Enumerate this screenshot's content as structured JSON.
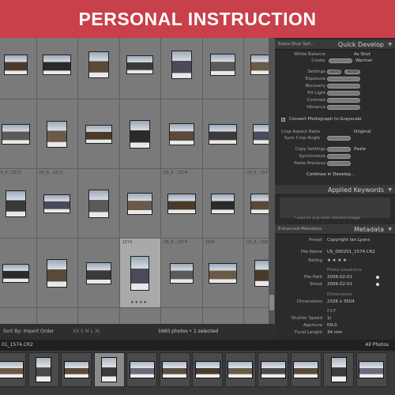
{
  "banner": {
    "text": "PERSONAL INSTRUCTION"
  },
  "grid": {
    "row1_labels": [
      "1574",
      "US_6...1553",
      "",
      "1557",
      "US_6...1559",
      "",
      "US_6...1560"
    ],
    "row3_labels": [
      "US_6...1571",
      "US_6...1573",
      "",
      "",
      "US_6...1574",
      "",
      "US_6...1577"
    ],
    "row4_labels": [
      "",
      "",
      "",
      "1574",
      "US_6...1574",
      "1582",
      "US_6...1583"
    ],
    "stars_selected": "★★★★·"
  },
  "toolbar": {
    "sort_label": "Sort By: Import Order",
    "sizes": "XS  S  M  L  XL",
    "count": "1660 photos • 1 selected"
  },
  "filmbar": {
    "filename": "01_1574.CR2",
    "filter": "All Photos"
  },
  "panel": {
    "preset_strip": "Sepia Blue Spli...",
    "quick_develop": {
      "title": "Quick Develop",
      "white_balance_label": "White Balance",
      "white_balance_value": "As Shot",
      "cooler": "Cooler",
      "warmer": "Warmer",
      "settings_label": "Settings",
      "auto": "AUTO",
      "reset": "RESET",
      "exposure": "Exposure",
      "recovery": "Recovery",
      "fill_light": "Fill Light",
      "contrast": "Contrast",
      "vibrance": "Vibrance",
      "convert_grayscale": "Convert Photograph to Grayscale",
      "crop_aspect": "Crop Aspect Ratio",
      "crop_value": "Original",
      "sync_crop": "Sync Crop Angle",
      "copy_settings": "Copy Settings",
      "paste": "Paste",
      "synchronize": "Synchronize",
      "paste_previous": "Paste Previous",
      "continue": "Continue in Develop..."
    },
    "applied_keywords": {
      "title": "Applied Keywords",
      "note": "* used on only some selected images"
    },
    "metadata": {
      "title": "Metadata",
      "enhanced": "Enhanced Metadata",
      "preset_label": "Preset",
      "preset_value": "Copyright Ian Lyons",
      "file_name_label": "File Name",
      "file_name_value": "US_000201_1574.CR2",
      "rating_label": "Rating",
      "rating_value": "★ ★ ★ ★ ·",
      "photo_locations": "Photo Locations",
      "file_path_label": "File Path",
      "file_path_value": "2006-02-01",
      "shoot_label": "Shoot",
      "shoot_value": "2006-02-01",
      "dimensions_section": "Dimensions",
      "dimensions_label": "Dimensions",
      "dimensions_value": "2336 x 3504",
      "exif": "EXIF",
      "shutter_label": "Shutter Speed",
      "shutter_value": "1/",
      "aperture_label": "Aperture",
      "aperture_value": "f/9.0",
      "focal_label": "Focal Length",
      "focal_value": "34 mm"
    }
  },
  "colors": {
    "banner": "#c8404a",
    "grid_bg": "#6b6b6b",
    "panel_bg": "#2b2b2b"
  }
}
